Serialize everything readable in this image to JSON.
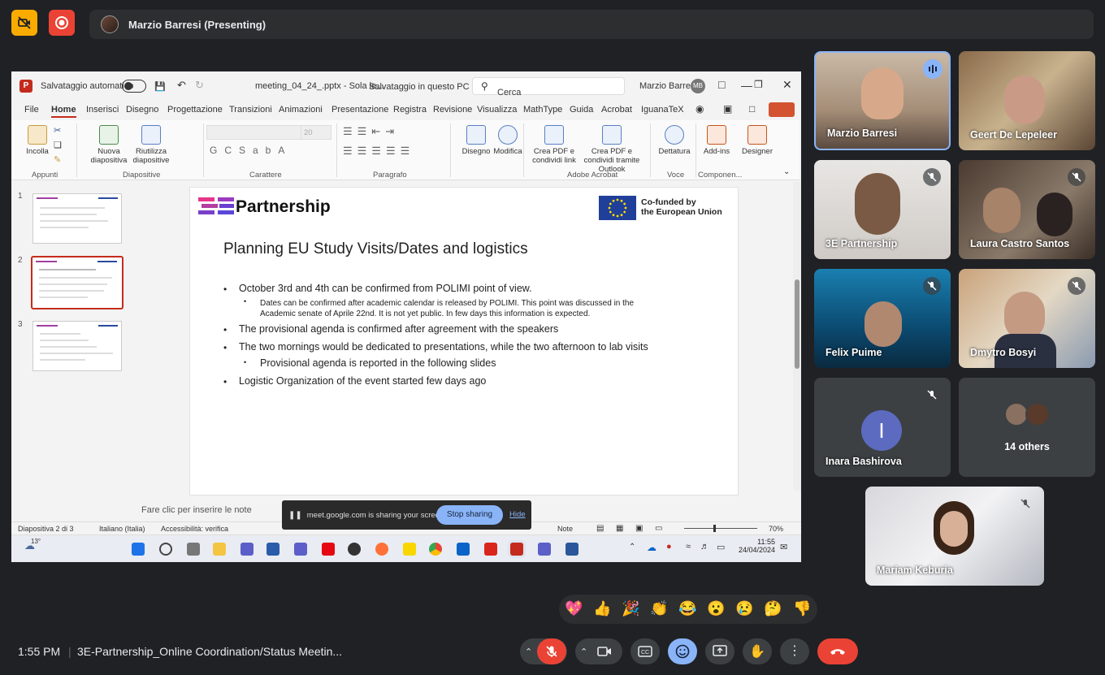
{
  "meet": {
    "presenter": "Marzio Barresi (Presenting)",
    "clock": "1:55 PM",
    "meeting_title": "3E-Partnership_Online Coordination/Status Meetin..."
  },
  "ppt": {
    "autosave": "Salvataggio automatico",
    "filename": "meeting_04_24_.pptx  -  Sola le...",
    "saved": "Salvataggio in questo PC ∨",
    "search_placeholder": "Cerca",
    "user": "Marzio Barresi",
    "user_initials": "MB",
    "menu": [
      "File",
      "Home",
      "Inserisci",
      "Disegno",
      "Progettazione",
      "Transizioni",
      "Animazioni",
      "Presentazione",
      "Registra",
      "Revisione",
      "Visualizza",
      "MathType",
      "Guida",
      "Acrobat",
      "IguanaTeX"
    ],
    "ribbon": {
      "incolla": "Incolla",
      "nuova": "Nuova diapositiva",
      "riutilizza": "Riutilizza diapositive",
      "disegno": "Disegno",
      "modifica": "Modifica",
      "crea_pdf_link": "Crea PDF e condividi link",
      "crea_pdf_outlook": "Crea PDF e condividi tramite Outlook",
      "dettatura": "Dettatura",
      "addins": "Add-ins",
      "designer": "Designer",
      "font_size": "20",
      "groups": {
        "appunti": "Appunti",
        "diapositive": "Diapositive",
        "carattere": "Carattere",
        "paragrafo": "Paragrafo",
        "adobe": "Adobe Acrobat",
        "voce": "Voce",
        "componenti": "Componen..."
      }
    },
    "thumb_numbers": [
      "1",
      "2",
      "3"
    ],
    "slide": {
      "logo": "Partnership",
      "eu_line1": "Co-funded by",
      "eu_line2": "the European Union",
      "title": "Planning EU Study Visits/Dates and logistics",
      "b1": "October 3rd and 4th can be confirmed from POLIMI point of view.",
      "b1s1": "Dates can be confirmed after academic calendar is released by POLIMI. This point was discussed in the",
      "b1s2": "Academic senate of Aprile 22nd. It is not yet public. In few days this information is expected.",
      "b2": "The provisional agenda is confirmed after agreement with the speakers",
      "b3": "The two mornings would be dedicated to presentations, while the two afternoon to lab visits",
      "b3s": "Provisional agenda is reported in the following slides",
      "b4": "Logistic Organization of the event started few days ago"
    },
    "notes_placeholder": "Fare clic per inserire le note",
    "status": {
      "slide": "Diapositiva 2 di 3",
      "lang": "Italiano (Italia)",
      "access": "Accessibilità: verifica",
      "note": "Note",
      "zoom": "70%"
    },
    "share_banner": "meet.google.com is sharing your screen.",
    "stop_sharing": "Stop sharing",
    "hide": "Hide",
    "taskbar": {
      "temp": "13°",
      "time": "11:55",
      "date": "24/04/2024"
    }
  },
  "participants": [
    {
      "name": "Marzio Barresi"
    },
    {
      "name": "Geert De Lepeleer"
    },
    {
      "name": "3E Partnership"
    },
    {
      "name": "Laura Castro Santos"
    },
    {
      "name": "Felix Puime"
    },
    {
      "name": "Dmytro Bosyi"
    },
    {
      "name": "Inara Bashirova",
      "initial": "I"
    },
    {
      "name": "14 others"
    },
    {
      "name": "Mariam Keburia"
    }
  ],
  "reactions": [
    "💖",
    "👍",
    "🎉",
    "👏",
    "😂",
    "😮",
    "😢",
    "🤔",
    "👎"
  ],
  "colors": {
    "accent": "#8ab4f8",
    "danger": "#ea4335",
    "bg": "#202124",
    "ppt_red": "#c42b1c"
  }
}
